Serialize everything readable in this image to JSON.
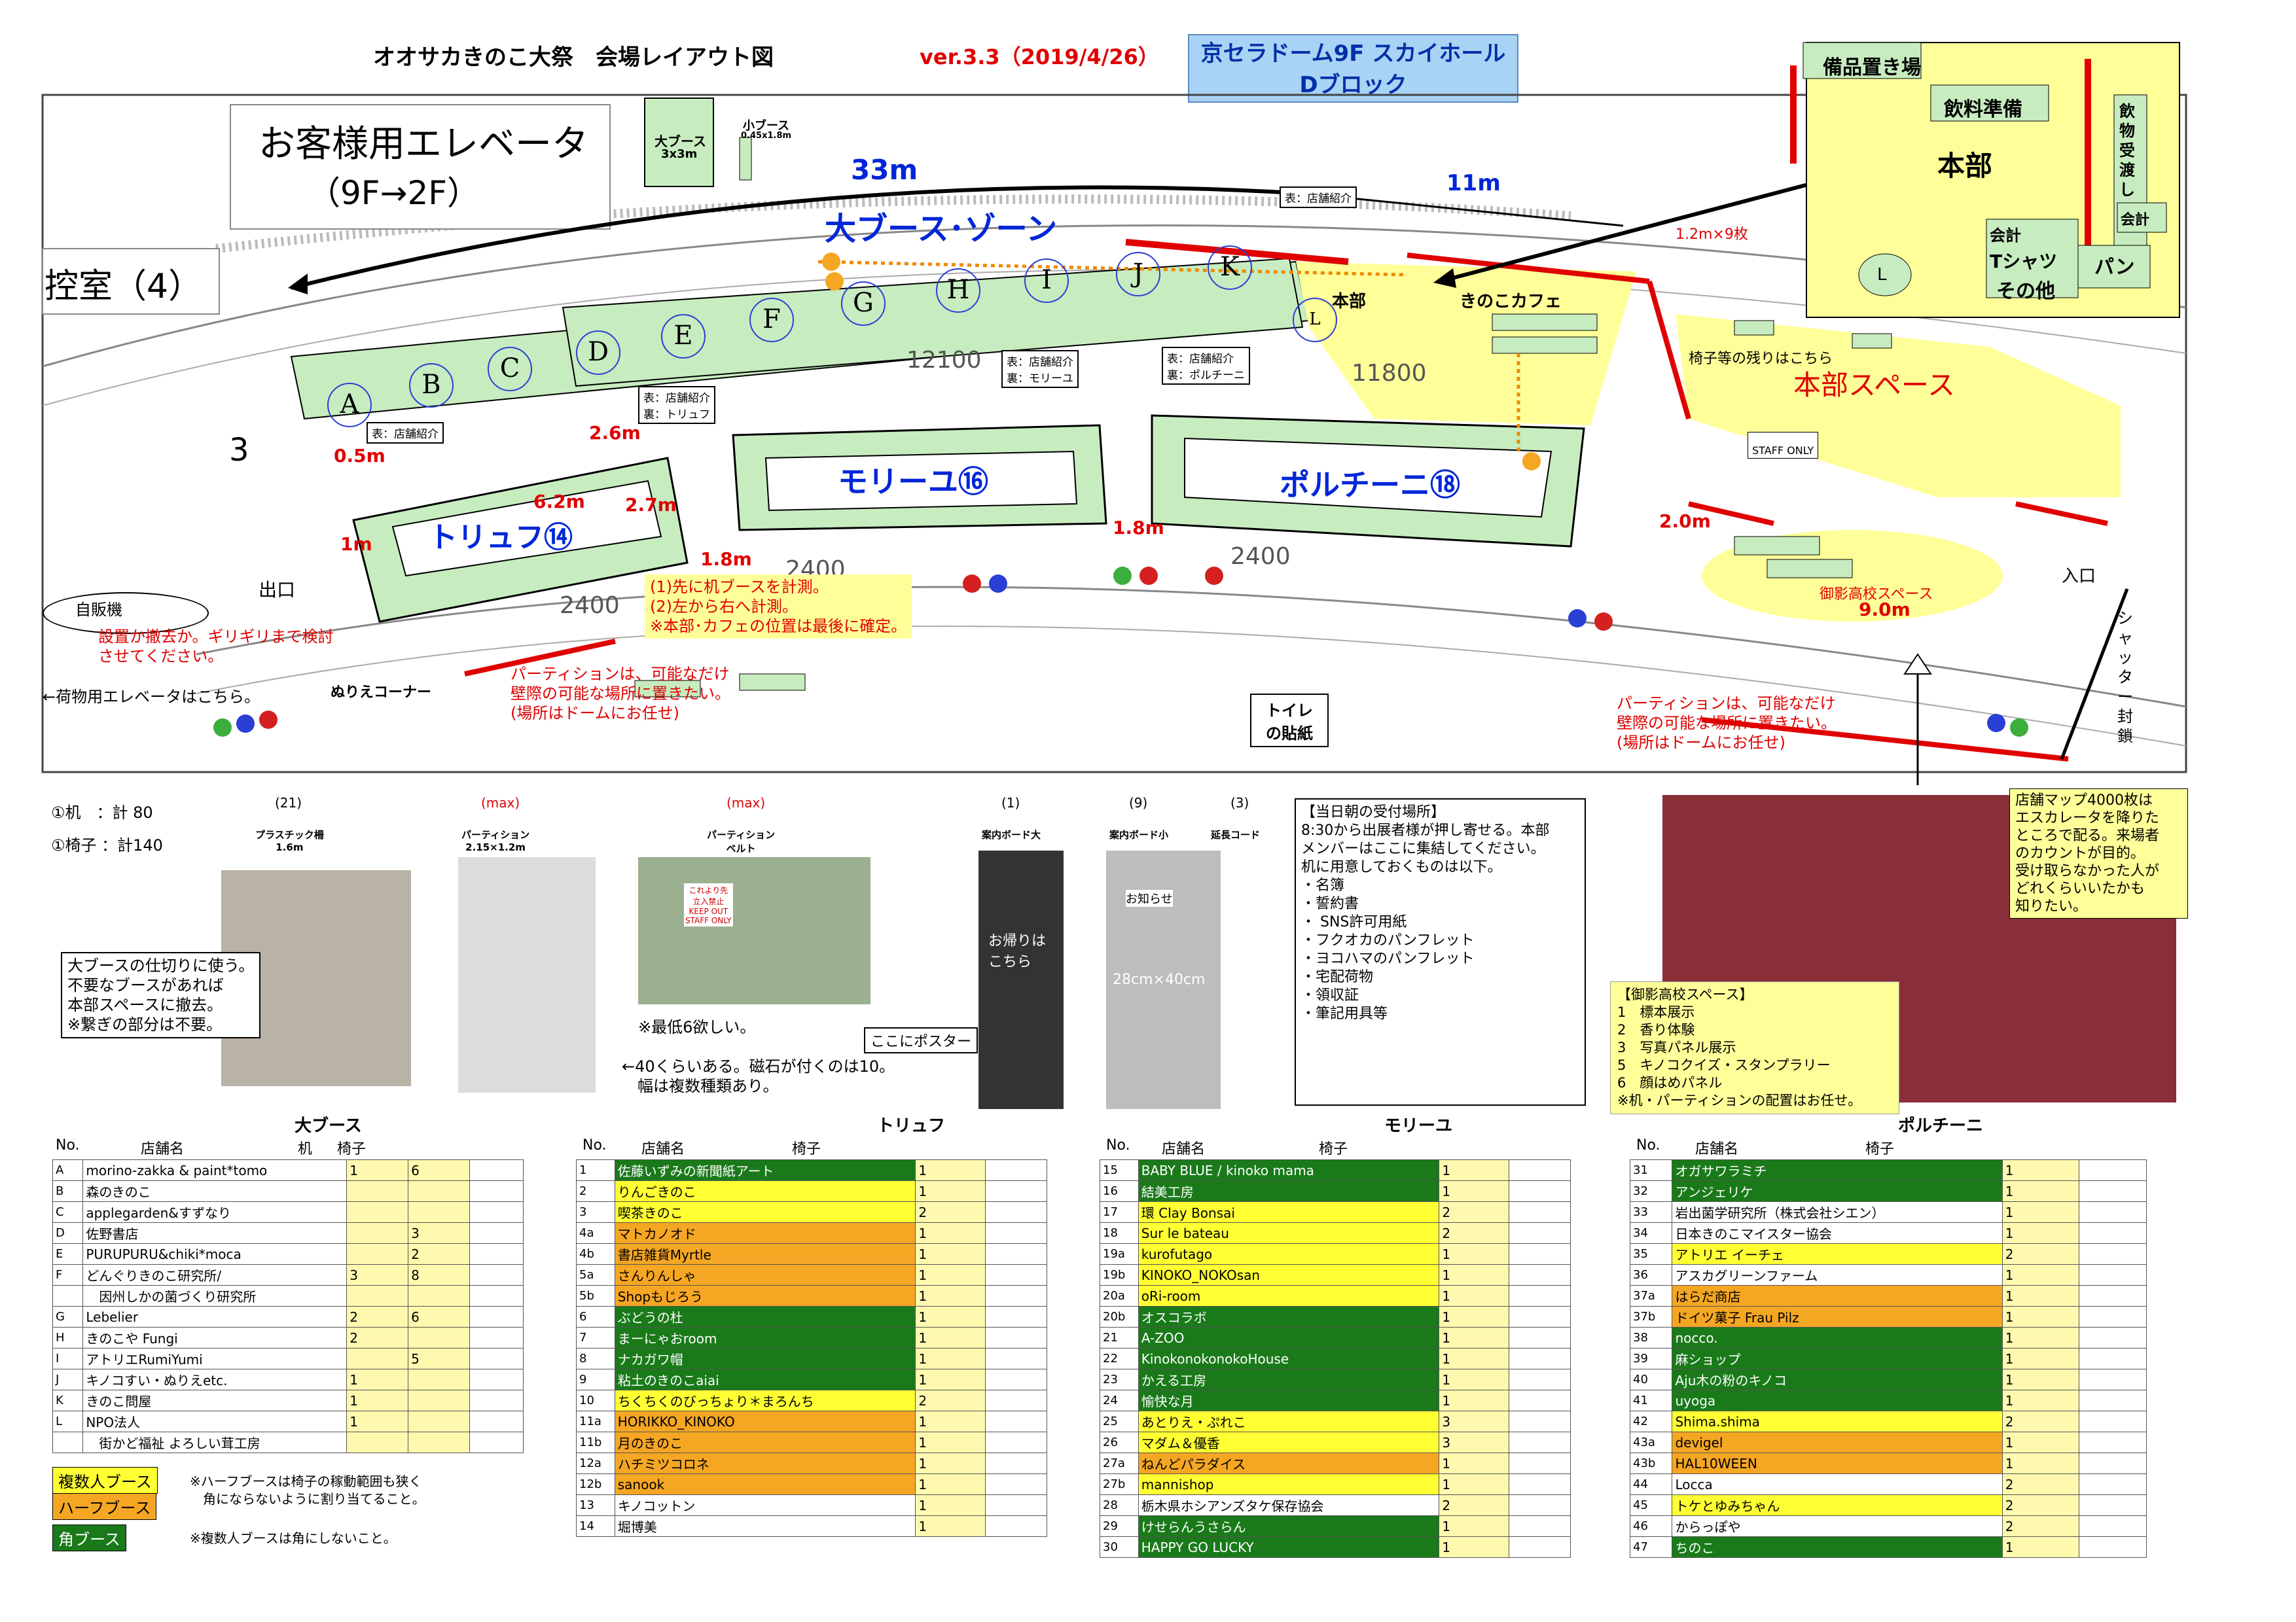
{
  "header": {
    "title": "オオサカきのこ大祭　会場レイアウト図",
    "version": "ver.3.3（2019/4/26）",
    "venue_line1": "京セラドーム9F スカイホール",
    "venue_line2": "Dブロック"
  },
  "map": {
    "elevator_title": "お客様用エレベータ",
    "elevator_floors": "（9F→2F）",
    "waiting_room": "控室（4）",
    "room_num": "3",
    "exit": "出口",
    "entrance": "入口",
    "legend_big": "大ブース",
    "legend_big_size": "3x3m",
    "legend_small": "小ブース",
    "legend_small_size": "0.45x1.8m",
    "dim_33": "33m",
    "dim_11": "11m",
    "dim_12100": "12100",
    "dim_11800": "11800",
    "dim_2400a": "2400",
    "dim_2400b": "2400",
    "dim_2400c": "2400",
    "dim_05": "0.5m",
    "dim_1m": "1m",
    "dim_26": "2.6m",
    "dim_62": "6.2m",
    "dim_27": "2.7m",
    "dim_18a": "1.8m",
    "dim_18b": "1.8m",
    "dim_20": "2.0m",
    "dim_90": "9.0m",
    "dim_12x9": "1.2m×9枚",
    "zone_big": "大ブース･ゾーン",
    "zone_truffe": "トリュフ⑭",
    "zone_morille": "モリーユ⑯",
    "zone_porcini": "ポルチーニ⑱",
    "zone_hq": "本部スペース",
    "hq_label": "本部",
    "cafe": "きのこカフェ",
    "chairs_note": "椅子等の残りはこちら",
    "staff_only": "STAFF ONLY",
    "mikage": "御影高校スペース",
    "booths": [
      "A",
      "B",
      "C",
      "D",
      "E",
      "F",
      "G",
      "H",
      "I",
      "J",
      "K",
      "L"
    ],
    "sign_shop": "表：店舗紹介",
    "sign_truffe": "表：店舗紹介\n裏：トリュフ",
    "sign_morille": "表：店舗紹介\n裏：モリーユ",
    "sign_porcini": "表：店舗紹介\n裏：ポルチーニ",
    "yellow_note": "(1)先に机ブースを計測。\n(2)左から右へ計測。\n※本部･カフェの位置は最後に確定。",
    "vending": "自販機",
    "vending_note": "設置か撤去か。ギリギリまで検討\nさせてください。",
    "cargo_elev": "←荷物用エレベータはこちら。",
    "nurie": "ぬりえコーナー",
    "partition_left": "パーティションは、可能なだけ\n壁際の可能な場所に置きたい。\n(場所はドームにお任せ)",
    "partition_right": "パーティションは、可能なだけ\n壁際の可能な場所に置きたい。\n(場所はドームにお任せ)",
    "toilet": "トイレ\nの貼紙",
    "shutter": "シャッター封鎖",
    "inset": {
      "bihin": "備品置き場",
      "drinks": "飲料準備",
      "honbu": "本部",
      "drink_accept": "飲物受渡し",
      "kaikei1": "会計",
      "kaikei2": "会計",
      "tshirt": "Tシャツ",
      "pan": "パン",
      "other": "その他",
      "L": "L"
    }
  },
  "equipment": {
    "desk_count": "①机　：計 80",
    "chair_count": "①椅子 ：計140",
    "items": [
      {
        "qty": "(21)",
        "name": "プラスチック柵",
        "size": "1.6m"
      },
      {
        "qty": "(max)",
        "name": "パーティション",
        "size": "2.15×1.2m"
      },
      {
        "qty": "(max)",
        "name": "パーティション\nベルト",
        "size": ""
      },
      {
        "qty": "(1)",
        "name": "案内ボード大",
        "size": ""
      },
      {
        "qty": "(9)",
        "name": "案内ボード小",
        "size": ""
      },
      {
        "qty": "(3)",
        "name": "延長コード",
        "size": ""
      }
    ],
    "big_booth_note": "大ブースの仕切りに使う。\n不要なブースがあれば\n本部スペースに撤去。\n※繋ぎの部分は不要。",
    "belt_note": "※最低6欲しい。",
    "partition_note": "←40くらいある。磁石が付くのは10。\n　幅は複数種類あり。",
    "poster_note": "ここにポスター",
    "board_size": "28cm×40cm",
    "photo_sign1": "これより先\n立入禁止\nKEEP OUT\nSTAFF ONLY",
    "photo_sign2": "お帰りは\nこちら",
    "photo_sign3": "お知らせ"
  },
  "reception": {
    "title": "【当日朝の受付場所】",
    "lines": [
      "8:30から出展者様が押し寄せる。本部",
      "メンバーはここに集結してください。",
      "机に用意しておくものは以下。",
      "・名簿",
      "・誓約書",
      "・ SNS許可用紙",
      "・フクオカのパンフレット",
      "・ヨコハマのパンフレット",
      "・宅配荷物",
      "・領収証",
      "・筆記用具等"
    ]
  },
  "mikage_box": {
    "title": "【御影高校スペース】",
    "lines": [
      "1　標本展示",
      "2　香り体験",
      "3　写真パネル展示",
      "5　キノコクイズ・スタンプラリー",
      "6　顔はめパネル",
      "※机・パーティションの配置はお任せ。"
    ]
  },
  "map_note": {
    "lines": [
      "店舗マップ4000枚は",
      "エスカレータを降りた",
      "ところで配る。来場者",
      "のカウントが目的。",
      "受け取らなかった人が",
      "どれくらいいたかも",
      "知りたい。"
    ]
  },
  "tables": {
    "big": {
      "title": "大ブース",
      "h_no": "No.",
      "h_name": "店舗名",
      "h_desk": "机",
      "h_chair": "椅子",
      "rows": [
        {
          "no": "A",
          "name": "morino-zakka & paint*tomo",
          "desk": "1",
          "chair": "6"
        },
        {
          "no": "B",
          "name": "森のきのこ",
          "desk": "",
          "chair": ""
        },
        {
          "no": "C",
          "name": "applegarden&すずなり",
          "desk": "",
          "chair": ""
        },
        {
          "no": "D",
          "name": "佐野書店",
          "desk": "",
          "chair": "3"
        },
        {
          "no": "E",
          "name": "PURUPURU&chiki*moca",
          "desk": "",
          "chair": "2"
        },
        {
          "no": "F",
          "name": "どんぐりきのこ研究所/",
          "desk": "3",
          "chair": "8"
        },
        {
          "no": "",
          "name": "　因州しかの菌づくり研究所",
          "desk": "",
          "chair": ""
        },
        {
          "no": "G",
          "name": "Lebelier",
          "desk": "2",
          "chair": "6"
        },
        {
          "no": "H",
          "name": "きのこや Fungi",
          "desk": "2",
          "chair": ""
        },
        {
          "no": "I",
          "name": "アトリエRumiYumi",
          "desk": "",
          "chair": "5"
        },
        {
          "no": "J",
          "name": "キノコすい・ぬりえetc.",
          "desk": "1",
          "chair": ""
        },
        {
          "no": "K",
          "name": "きのこ問屋",
          "desk": "1",
          "chair": ""
        },
        {
          "no": "L",
          "name": "NPO法人",
          "desk": "1",
          "chair": ""
        },
        {
          "no": "",
          "name": "　街かど福祉 よろしい茸工房",
          "desk": "",
          "chair": ""
        }
      ],
      "legend_multi": "複数人ブース",
      "legend_half": "ハーフブース",
      "legend_corner": "角ブース",
      "note1": "※ハーフブースは椅子の稼動範囲も狭く",
      "note2": "角にならないように割り当てること。",
      "note3": "※複数人ブースは角にしないこと。"
    },
    "truffe": {
      "title": "トリュフ",
      "h_no": "No.",
      "h_name": "店舗名",
      "h_chair": "椅子",
      "rows": [
        {
          "no": "1",
          "name": "佐藤いずみの新聞紙アート",
          "chair": "1",
          "c": "g"
        },
        {
          "no": "2",
          "name": "りんごきのこ",
          "chair": "1",
          "c": "y"
        },
        {
          "no": "3",
          "name": "喫茶きのこ",
          "chair": "2",
          "c": "y"
        },
        {
          "no": "4a",
          "name": "マトカノオド",
          "chair": "1",
          "c": "o"
        },
        {
          "no": "4b",
          "name": "書店雑貨Myrtle",
          "chair": "1",
          "c": "o"
        },
        {
          "no": "5a",
          "name": "さんりんしゃ",
          "chair": "1",
          "c": "o"
        },
        {
          "no": "5b",
          "name": "Shopもじろう",
          "chair": "1",
          "c": "o"
        },
        {
          "no": "6",
          "name": "ぶどうの杜",
          "chair": "1",
          "c": "g"
        },
        {
          "no": "7",
          "name": "まーにゃおroom",
          "chair": "1",
          "c": "g"
        },
        {
          "no": "8",
          "name": "ナカガワ帽",
          "chair": "1",
          "c": "g"
        },
        {
          "no": "9",
          "name": "粘土のきのこaiai",
          "chair": "1",
          "c": "g"
        },
        {
          "no": "10",
          "name": "ちくちくのびっちょり＊まろんち",
          "chair": "2",
          "c": "y"
        },
        {
          "no": "11a",
          "name": "HORIKKO_KINOKO",
          "chair": "1",
          "c": "o"
        },
        {
          "no": "11b",
          "name": "月のきのこ",
          "chair": "1",
          "c": "o"
        },
        {
          "no": "12a",
          "name": "ハチミツコロネ",
          "chair": "1",
          "c": "o"
        },
        {
          "no": "12b",
          "name": "sanook",
          "chair": "1",
          "c": "o"
        },
        {
          "no": "13",
          "name": "キノコットン",
          "chair": "1",
          "c": ""
        },
        {
          "no": "14",
          "name": "堀博美",
          "chair": "1",
          "c": ""
        }
      ]
    },
    "morille": {
      "title": "モリーユ",
      "h_no": "No.",
      "h_name": "店舗名",
      "h_chair": "椅子",
      "rows": [
        {
          "no": "15",
          "name": "BABY BLUE / kinoko mama",
          "chair": "1",
          "c": "g"
        },
        {
          "no": "16",
          "name": "結美工房",
          "chair": "1",
          "c": "g"
        },
        {
          "no": "17",
          "name": "環 Clay Bonsai",
          "chair": "2",
          "c": "y"
        },
        {
          "no": "18",
          "name": "Sur le bateau",
          "chair": "2",
          "c": "y"
        },
        {
          "no": "19a",
          "name": "kurofutago",
          "chair": "1",
          "c": "y"
        },
        {
          "no": "19b",
          "name": "KINOKO_NOKOsan",
          "chair": "1",
          "c": "y"
        },
        {
          "no": "20a",
          "name": "oRi-room",
          "chair": "1",
          "c": "y"
        },
        {
          "no": "20b",
          "name": "オスコラボ",
          "chair": "1",
          "c": "g"
        },
        {
          "no": "21",
          "name": "A-ZOO",
          "chair": "1",
          "c": "g"
        },
        {
          "no": "22",
          "name": "KinokonokonokoHouse",
          "chair": "1",
          "c": "g"
        },
        {
          "no": "23",
          "name": "かえる工房",
          "chair": "1",
          "c": "g"
        },
        {
          "no": "24",
          "name": "愉快な月",
          "chair": "1",
          "c": "g"
        },
        {
          "no": "25",
          "name": "あとりえ・ぷれこ",
          "chair": "3",
          "c": "y"
        },
        {
          "no": "26",
          "name": "マダム＆優香",
          "chair": "3",
          "c": "y"
        },
        {
          "no": "27a",
          "name": "ねんどパラダイス",
          "chair": "1",
          "c": "o"
        },
        {
          "no": "27b",
          "name": "mannishop",
          "chair": "1",
          "c": "y"
        },
        {
          "no": "28",
          "name": "栃木県ホシアンズタケ保存協会",
          "chair": "2",
          "c": ""
        },
        {
          "no": "29",
          "name": "けせらんうさらん",
          "chair": "1",
          "c": "g"
        },
        {
          "no": "30",
          "name": "HAPPY GO LUCKY",
          "chair": "1",
          "c": "g"
        }
      ]
    },
    "porcini": {
      "title": "ポルチーニ",
      "h_no": "No.",
      "h_name": "店舗名",
      "h_chair": "椅子",
      "rows": [
        {
          "no": "31",
          "name": "オガサワラミチ",
          "chair": "1",
          "c": "g"
        },
        {
          "no": "32",
          "name": "アンジェリケ",
          "chair": "1",
          "c": "g"
        },
        {
          "no": "33",
          "name": "岩出菌学研究所（株式会社シエン）",
          "chair": "1",
          "c": ""
        },
        {
          "no": "34",
          "name": "日本きのこマイスター協会",
          "chair": "1",
          "c": ""
        },
        {
          "no": "35",
          "name": "アトリエ イーチェ",
          "chair": "2",
          "c": "y"
        },
        {
          "no": "36",
          "name": "アスカグリーンファーム",
          "chair": "1",
          "c": ""
        },
        {
          "no": "37a",
          "name": "はらだ商店",
          "chair": "1",
          "c": "o"
        },
        {
          "no": "37b",
          "name": "ドイツ菓子 Frau Pilz",
          "chair": "1",
          "c": "o"
        },
        {
          "no": "38",
          "name": "nocco.",
          "chair": "1",
          "c": "g"
        },
        {
          "no": "39",
          "name": "麻ショップ",
          "chair": "1",
          "c": "g"
        },
        {
          "no": "40",
          "name": "Aju木の粉のキノコ",
          "chair": "1",
          "c": "g"
        },
        {
          "no": "41",
          "name": "uyoga",
          "chair": "1",
          "c": "g"
        },
        {
          "no": "42",
          "name": "Shima.shima",
          "chair": "2",
          "c": "y"
        },
        {
          "no": "43a",
          "name": "devigel",
          "chair": "1",
          "c": "o"
        },
        {
          "no": "43b",
          "name": "HAL10WEEN",
          "chair": "1",
          "c": "o"
        },
        {
          "no": "44",
          "name": "Locca",
          "chair": "2",
          "c": ""
        },
        {
          "no": "45",
          "name": "トケとゆみちゃん",
          "chair": "2",
          "c": "y"
        },
        {
          "no": "46",
          "name": "からっぽや",
          "chair": "2",
          "c": ""
        },
        {
          "no": "47",
          "name": "ちのこ",
          "chair": "1",
          "c": "g"
        }
      ]
    }
  },
  "colors": {
    "booth_green": "#c7ecc0",
    "hq_yellow": "#ffff99",
    "red": "#e00000",
    "blue": "#0026d8",
    "corner": "#1a7a1a",
    "multi": "#ffff33",
    "half": "#f5a623"
  }
}
